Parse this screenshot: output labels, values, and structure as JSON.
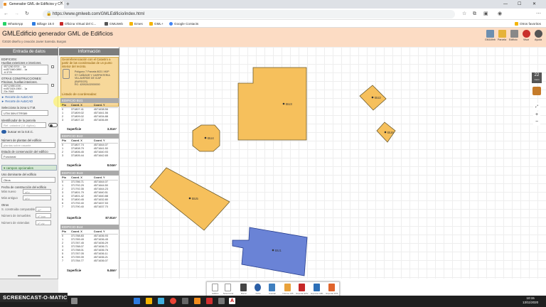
{
  "browser": {
    "tab_title": "Generador GML de Edificios y C...",
    "url": "https://www.gmlweb.com/GMLEdificio/index.html",
    "bookmarks": [
      "WhatsApp",
      "Billage 18.0",
      "Oficina Virtual del C...",
      "GMLWeb",
      "Emes",
      "GML+",
      "Google Contacts"
    ],
    "other_bookmarks": "Otros favoritos"
  },
  "app": {
    "title_bold": "GMLEdificio",
    "title_rest": "generador GML de Edificios",
    "subtitle": "©2020 diseño y creación Javier Sarreda. Burgos",
    "tools": [
      "GMLWeb",
      "Parcela",
      "Edificio",
      "Visor",
      "Ayuda"
    ],
    "user": "BT1003579BU"
  },
  "left": {
    "header": "Entrada de datos",
    "edificios_label": "EDIFICIOS:",
    "edificios_sub": "Huellas exteriores e interiores.",
    "edif_box": "4571260.5700 ... 1a\nrx4571660.0890 .. 1a\n-6.3720",
    "otras_label": "OTRAS CONSTRUCCIONES:",
    "otras_sub": "Piscinas, huellas interiores.",
    "otras_box": "45712458.1000 ..\nrx4571624.1500 .. 1a\n23x.7648",
    "recorte1": "► Recorte de AutoCAD",
    "recorte2": "► Recorte de AutoCAD",
    "zona_label": "Selecciona la zona U.T.M.",
    "zona_value": "UTM 30N ETRS89",
    "parcela_label": "Identificador de la parcela",
    "parcela_ph": "Ref. catastral (14 dígitos)",
    "buscar": "buscar en la S.E.C.",
    "plantas_label": "Número de plantas del edificio",
    "plantas_ph": "plantas sobre rasante",
    "estado_label": "Estado de conservación del edificio",
    "estado_value": "Funcional",
    "opcionales": "campos opcionales",
    "uso_label": "Uso dominante del edificio",
    "uso_value": "Otros",
    "fecha_label": "Fecha de construcción del edificio",
    "mas_nuevo": "Más nuevo",
    "mas_antiguo": "Más antiguo",
    "anio": "año",
    "otros": "Otros",
    "s_construida": "S. construida computable",
    "s_unit": "m²",
    "inmuebles": "Número de inmuebles",
    "inmuebles_ph": "nº inm",
    "viviendas": "Número de viviendas",
    "viviendas_ph": "nº viv"
  },
  "right": {
    "header": "Información",
    "note_title": "Georreferenciación con el Catastro a partir de las coordenadas de un punto interior del recinto.",
    "note_addr": "Polígono 7 Parcela 8021 XKIP\nST CAÑIZAR Y CARPINTERIA\nVILLAVERDE DE ICAP\n(BURGOS)\nRC: 42092A02000000",
    "note_link": "Listado de coordenadas:",
    "buildings": [
      {
        "name": "EDIFICIO BU1",
        "rows": [
          [
            "0",
            "371807.41",
            "4571638.56"
          ],
          [
            "1",
            "371809.02",
            "4571641.56"
          ],
          [
            "2",
            "371809.02",
            "4571634.88"
          ],
          [
            "3",
            "371807.22",
            "4571636.89"
          ]
        ],
        "sup": "3.31m²"
      },
      {
        "name": "EDIFICIO BU2",
        "rows": [
          [
            "0",
            "371807.74",
            "4571644.07"
          ],
          [
            "1",
            "371808.79",
            "4571641.50"
          ],
          [
            "2",
            "371806.45",
            "4571640.93"
          ],
          [
            "3",
            "371805.44",
            "4571642.65"
          ]
        ],
        "sup": "8.04m²"
      },
      {
        "name": "EDIFICIO BU3",
        "rows": [
          [
            "0",
            "371786.71",
            "4571644.07"
          ],
          [
            "1",
            "371792.29",
            "4571644.50"
          ],
          [
            "2",
            "371792.35",
            "4571644.23"
          ],
          [
            "3",
            "371801.79",
            "4571640.51"
          ],
          [
            "4",
            "371801.42",
            "4571640.88"
          ],
          [
            "5",
            "371800.45",
            "4571632.80"
          ],
          [
            "6",
            "371792.40",
            "4571637.53"
          ],
          [
            "7",
            "371790.40",
            "4571637.70"
          ]
        ],
        "sup": "87.91m²"
      },
      {
        "name": "EDIFICIO BU4",
        "rows": [
          [
            "0",
            "371788.83",
            "4571636.93"
          ],
          [
            "1",
            "371789.49",
            "4571636.45"
          ],
          [
            "2",
            "371787.45",
            "4571636.29"
          ],
          [
            "3",
            "371788.07",
            "4571636.71"
          ],
          [
            "4",
            "371788.01",
            "4571636.76"
          ],
          [
            "5",
            "371787.05",
            "4571636.11"
          ],
          [
            "6",
            "371789.39",
            "4571636.21"
          ],
          [
            "7",
            "371784.77",
            "4571636.07"
          ]
        ],
        "sup": "9.46m²"
      }
    ],
    "col_pto": "Pto",
    "col_x": "Coord. X",
    "col_y": "Coord. Y",
    "sup_label": "Superficie"
  },
  "map": {
    "labels": [
      "BU1",
      "BU2",
      "BU3",
      "BU4",
      "BU5",
      "BU6",
      "BU7"
    ],
    "zoom": "22",
    "zoom_sub": "zoom"
  },
  "bottom_tools": [
    "Edificio",
    "Seleccionar",
    "Borrar",
    "Ficha",
    "Guardar",
    "Coordenadas",
    "Informe GIS",
    "Exportar ENV",
    "Exportar GML",
    "Exportar DXF"
  ],
  "taskbar": {
    "time": "10:15",
    "date": "13/11/2020",
    "screencast": "SCREENCAST-O-MATIC"
  }
}
